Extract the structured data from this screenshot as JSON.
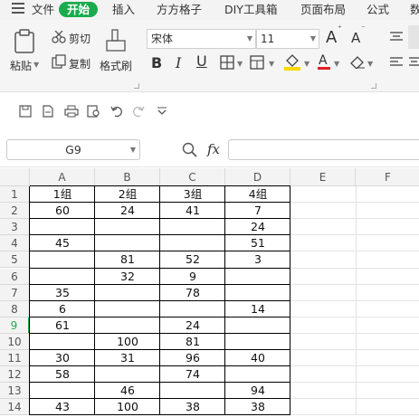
{
  "menu": {
    "file_label": "文件",
    "tabs": [
      "开始",
      "插入",
      "方方格子",
      "DIY工具箱",
      "页面布局",
      "公式",
      "数"
    ]
  },
  "ribbon": {
    "paste_label": "粘贴",
    "cut_label": "剪切",
    "copy_label": "复制",
    "format_painter_label": "格式刷",
    "font_name": "宋体",
    "font_size": "11",
    "bold": "B",
    "italic": "I",
    "underline": "U",
    "grow_font": "A",
    "shrink_font": "A"
  },
  "formula_bar": {
    "cell_ref": "G9",
    "fx_label": "fx",
    "formula": ""
  },
  "sheet": {
    "columns": [
      "A",
      "B",
      "C",
      "D",
      "E",
      "F"
    ],
    "rows": [
      [
        "1组",
        "2组",
        "3组",
        "4组"
      ],
      [
        "60",
        "24",
        "41",
        "7"
      ],
      [
        "",
        "",
        "",
        "24"
      ],
      [
        "45",
        "",
        "",
        "51"
      ],
      [
        "",
        "81",
        "52",
        "3"
      ],
      [
        "",
        "32",
        "9",
        ""
      ],
      [
        "35",
        "",
        "78",
        ""
      ],
      [
        "6",
        "",
        "",
        "14"
      ],
      [
        "61",
        "",
        "24",
        ""
      ],
      [
        "",
        "100",
        "81",
        ""
      ],
      [
        "30",
        "31",
        "96",
        "40"
      ],
      [
        "58",
        "",
        "74",
        ""
      ],
      [
        "",
        "46",
        "",
        "94"
      ],
      [
        "43",
        "100",
        "38",
        "38"
      ]
    ],
    "row_numbers": [
      "1",
      "2",
      "3",
      "4",
      "5",
      "6",
      "7",
      "8",
      "9",
      "10",
      "11",
      "12",
      "13",
      "14"
    ],
    "selected_row": "9",
    "accent_color": "#1aab4d"
  }
}
